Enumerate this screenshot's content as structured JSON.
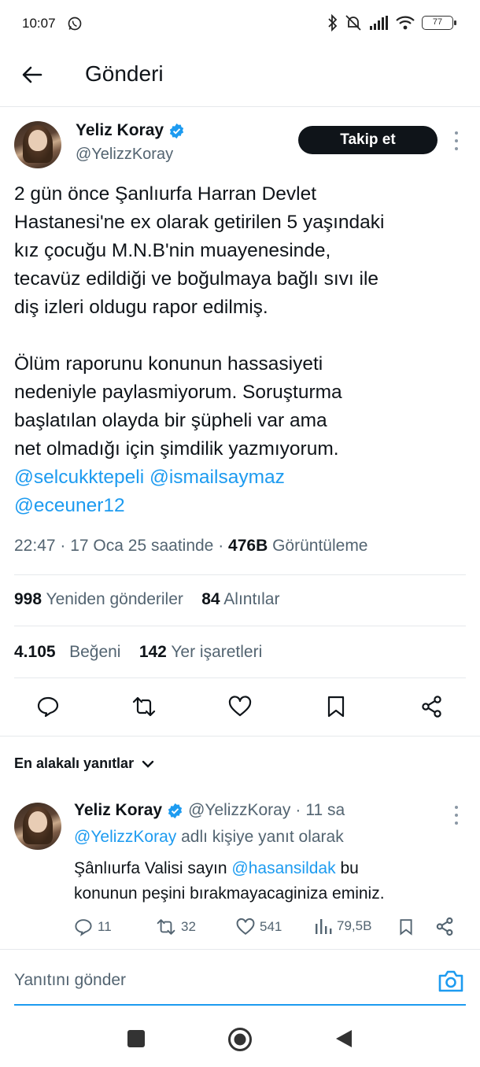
{
  "status_bar": {
    "time": "10:07",
    "battery": "77"
  },
  "header": {
    "title": "Gönderi"
  },
  "tweet": {
    "author_name": "Yeliz Koray",
    "author_handle": "@YelizzKoray",
    "follow_label": "Takip et",
    "lines": [
      "2 gün önce Şanlıurfa Harran Devlet",
      "Hastanesi'ne ex olarak getirilen 5 yaşındaki",
      "kız çocuğu M.N.B'nin muayenesinde,",
      "tecavüz edildiği ve  boğulmaya bağlı sıvı ile",
      "diş izleri oldugu rapor edilmiş."
    ],
    "lines2": [
      "Ölüm raporunu konunun hassasiyeti",
      "nedeniyle paylasmiyorum. Soruşturma",
      "başlatılan olayda bir şüpheli var ama",
      "net olmadığı için şimdilik yazmıyorum."
    ],
    "mentions": [
      "@selcukktepeli",
      "@ismailsaymaz",
      "@eceuner12"
    ],
    "time": "22:47",
    "date": "17 Oca 25 saatinde",
    "views_count": "476B",
    "views_label": "Görüntüleme",
    "reposts_count": "998",
    "reposts_label": "Yeniden gönderiler",
    "quotes_count": "84",
    "quotes_label": "Alıntılar",
    "likes_count": "4.105",
    "likes_label": "Beğeni",
    "bookmarks_count": "142",
    "bookmarks_label": "Yer işaretleri"
  },
  "replies_sort": {
    "label": "En alakalı yanıtlar"
  },
  "reply": {
    "author_name": "Yeliz Koray",
    "author_handle": "@YelizzKoray",
    "time_ago": "11 sa",
    "reply_to_mention": "@YelizzKoray",
    "reply_to_suffix": "adlı kişiye yanıt olarak",
    "text_part1": "Şânlıurfa Valisi sayın",
    "text_mention": "@hasansildak",
    "text_part2": "bu",
    "text_line2": "konunun peşini bırakmayacaginiza eminiz.",
    "replies": "11",
    "reposts": "32",
    "likes": "541",
    "views": "79,5B"
  },
  "compose": {
    "placeholder": "Yanıtını gönder"
  },
  "colors": {
    "accent": "#1d9bf0",
    "text": "#0f1419",
    "muted": "#536471"
  }
}
